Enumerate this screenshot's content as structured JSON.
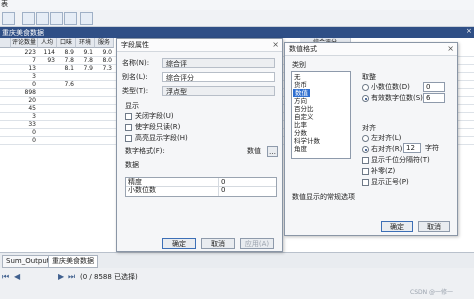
{
  "window": {
    "title_fragment": "表"
  },
  "table": {
    "caption": "重庆美食数据",
    "columns": [
      "评论数量",
      "人均",
      "口味",
      "环境",
      "服务",
      "综合评分"
    ]
  },
  "grid_rows": [
    [
      "223",
      "114",
      "8.9",
      "9.1",
      "9.0"
    ],
    [
      "7",
      "93",
      "7.8",
      "7.8",
      "8.0"
    ],
    [
      "13",
      "",
      "8.1",
      "7.9",
      "7.3"
    ],
    [
      "3",
      "",
      "",
      "",
      ""
    ],
    [
      "0",
      "",
      "7.6",
      "",
      ""
    ],
    [
      "898",
      "",
      "",
      "",
      ""
    ],
    [
      "20",
      "",
      "",
      "",
      ""
    ],
    [
      "45",
      "",
      "",
      "",
      ""
    ],
    [
      "3",
      "",
      "",
      "",
      ""
    ],
    [
      "33",
      "",
      "",
      "",
      ""
    ],
    [
      "0",
      "",
      "",
      "",
      ""
    ],
    [
      "0",
      "",
      "",
      "",
      ""
    ]
  ],
  "field_props": {
    "title": "字段属性",
    "name_label": "名称(N):",
    "name_value": "综合评",
    "alias_label": "别名(L):",
    "alias_value": "综合评分",
    "type_label": "类型(T):",
    "type_value": "浮点型",
    "display_label": "显示",
    "options": [
      {
        "label": "关闭字段(U)",
        "checked": false
      },
      {
        "label": "使字段只读(R)",
        "checked": false
      },
      {
        "label": "高亮显示字段(H)",
        "checked": false
      }
    ],
    "format_label": "数字格式(F):",
    "format_value": "数值",
    "data_label": "数据",
    "data_rows": [
      {
        "name": "精度",
        "value": "0"
      },
      {
        "name": "小数位数",
        "value": "0"
      }
    ],
    "ok": "确定",
    "cancel": "取消",
    "apply": "应用(A)"
  },
  "number_format": {
    "title": "数值格式",
    "category_label": "类别",
    "categories": [
      "无",
      "货币",
      "数值",
      "方向",
      "百分比",
      "自定义",
      "比率",
      "分数",
      "科学计数",
      "角度"
    ],
    "selected_category": "数值",
    "rounding_label": "取整",
    "rounding_options": [
      {
        "label": "小数位数(D)",
        "value": "0",
        "selected": false
      },
      {
        "label": "有效数字位数(S)",
        "value": "6",
        "selected": true
      }
    ],
    "align_label": "对齐",
    "align_options": [
      {
        "label": "左对齐(L)",
        "selected": false
      },
      {
        "label": "右对齐(R)",
        "selected": true
      }
    ],
    "align_width": "12",
    "align_unit": "字符",
    "checks": [
      {
        "label": "显示千位分隔符(T)",
        "checked": false
      },
      {
        "label": "补零(Z)",
        "checked": false
      },
      {
        "label": "显示正号(P)",
        "checked": false
      }
    ],
    "description": "数值显示的常规选项",
    "ok": "确定",
    "cancel": "取消"
  },
  "tabs": [
    "Sum_Output",
    "重庆美食数据"
  ],
  "status": {
    "record_text": "(0 / 8588 已选择)"
  },
  "footer_right": "CSDN @一修一"
}
